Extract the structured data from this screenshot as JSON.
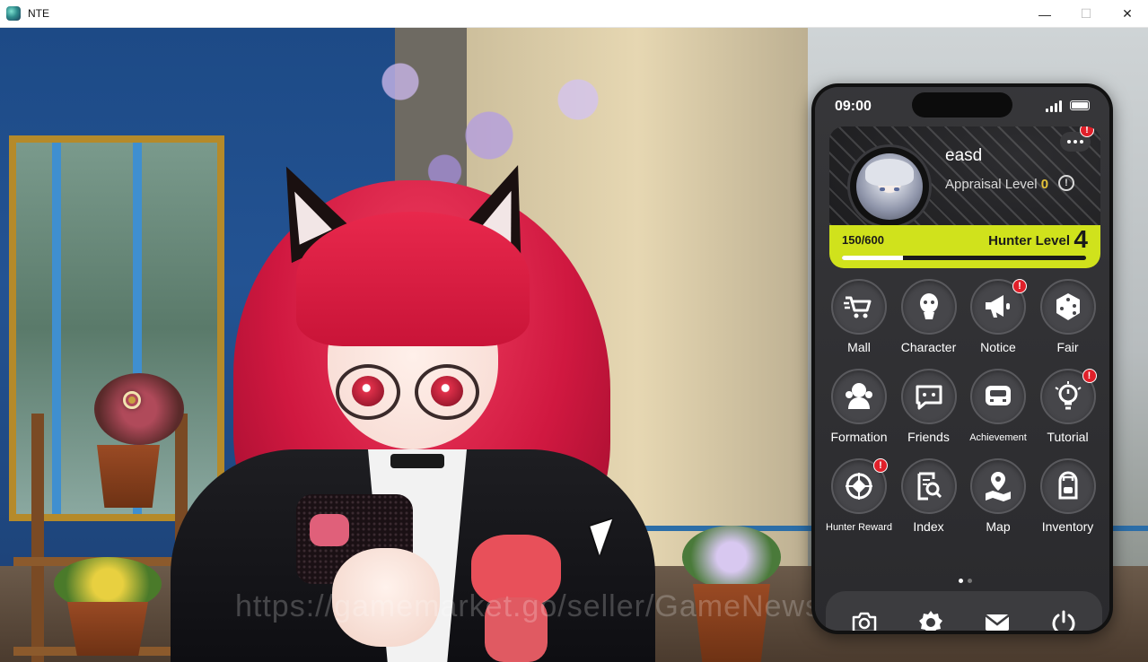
{
  "window": {
    "title": "NTE",
    "minimize_glyph": "—",
    "maximize_glyph": "☐",
    "close_glyph": "✕"
  },
  "watermark": "https://gamemarket.go/seller/GameNews",
  "phone": {
    "time": "09:00",
    "profile": {
      "username": "easd",
      "appraisal_label": "Appraisal Level",
      "appraisal_level": "0",
      "xp_text": "150/600",
      "xp_fraction": 0.25,
      "hunter_label": "Hunter Level",
      "hunter_level": "4",
      "more_badge": "!"
    },
    "apps": [
      {
        "label": "Mall",
        "icon": "cart-icon",
        "badge": ""
      },
      {
        "label": "Character",
        "icon": "character-icon",
        "badge": ""
      },
      {
        "label": "Notice",
        "icon": "megaphone-icon",
        "badge": "!"
      },
      {
        "label": "Fair",
        "icon": "dice-icon",
        "badge": ""
      },
      {
        "label": "Formation",
        "icon": "formation-icon",
        "badge": ""
      },
      {
        "label": "Friends",
        "icon": "chat-icon",
        "badge": ""
      },
      {
        "label": "Achievement",
        "icon": "achievement-icon",
        "badge": ""
      },
      {
        "label": "Tutorial",
        "icon": "lightbulb-icon",
        "badge": "!"
      },
      {
        "label": "Hunter Reward",
        "icon": "crosshair-icon",
        "badge": "!"
      },
      {
        "label": "Index",
        "icon": "index-search-icon",
        "badge": ""
      },
      {
        "label": "Map",
        "icon": "map-pin-icon",
        "badge": ""
      },
      {
        "label": "Inventory",
        "icon": "backpack-icon",
        "badge": ""
      }
    ],
    "page_count": 2,
    "active_page": 1,
    "dock": [
      "camera-icon",
      "settings-icon",
      "mail-icon",
      "power-icon"
    ]
  },
  "colors": {
    "accent": "#d0e21c",
    "badge": "#e0202a",
    "appraisal": "#e6c43a"
  }
}
